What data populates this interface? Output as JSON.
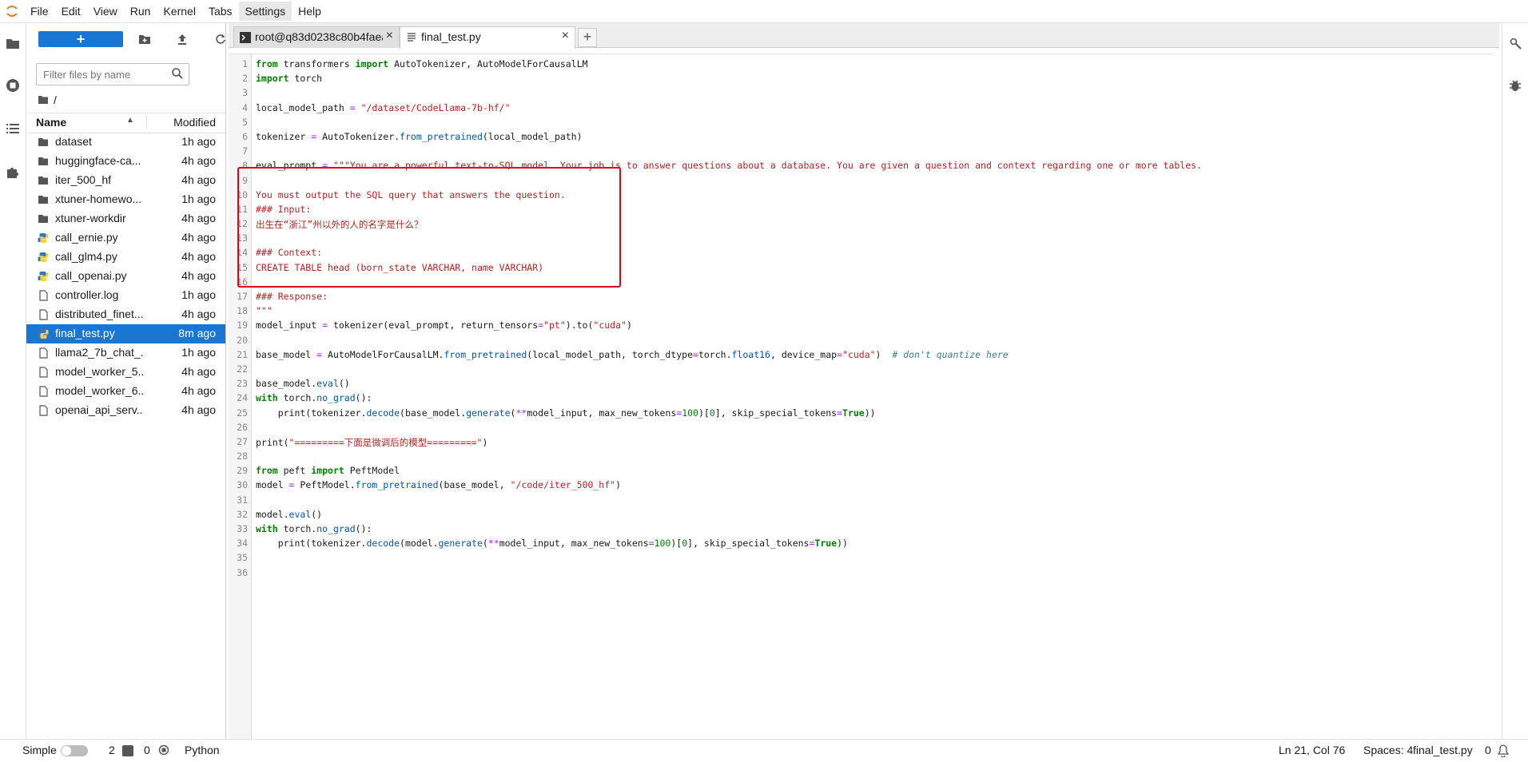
{
  "menubar": {
    "items": [
      "File",
      "Edit",
      "View",
      "Run",
      "Kernel",
      "Tabs",
      "Settings",
      "Help"
    ],
    "active": "Settings"
  },
  "filebrowser": {
    "new_label": "+",
    "filter_placeholder": "Filter files by name",
    "path": "/",
    "columns": {
      "name": "Name",
      "modified": "Modified"
    },
    "files": [
      {
        "name": "dataset",
        "time": "1h ago",
        "type": "folder"
      },
      {
        "name": "huggingface-ca...",
        "time": "4h ago",
        "type": "folder"
      },
      {
        "name": "iter_500_hf",
        "time": "4h ago",
        "type": "folder"
      },
      {
        "name": "xtuner-homewo...",
        "time": "1h ago",
        "type": "folder"
      },
      {
        "name": "xtuner-workdir",
        "time": "4h ago",
        "type": "folder"
      },
      {
        "name": "call_ernie.py",
        "time": "4h ago",
        "type": "python"
      },
      {
        "name": "call_glm4.py",
        "time": "4h ago",
        "type": "python"
      },
      {
        "name": "call_openai.py",
        "time": "4h ago",
        "type": "python"
      },
      {
        "name": "controller.log",
        "time": "1h ago",
        "type": "file"
      },
      {
        "name": "distributed_finet...",
        "time": "4h ago",
        "type": "file"
      },
      {
        "name": "final_test.py",
        "time": "8m ago",
        "type": "python",
        "selected": true
      },
      {
        "name": "llama2_7b_chat_...",
        "time": "1h ago",
        "type": "file"
      },
      {
        "name": "model_worker_5...",
        "time": "4h ago",
        "type": "file"
      },
      {
        "name": "model_worker_6...",
        "time": "4h ago",
        "type": "file"
      },
      {
        "name": "openai_api_serv...",
        "time": "4h ago",
        "type": "file"
      }
    ]
  },
  "tabs": [
    {
      "label": "root@q83d0238c80b4faea",
      "icon": "terminal-icon"
    },
    {
      "label": "final_test.py",
      "icon": "text-file-icon",
      "active": true
    }
  ],
  "status": {
    "mode": "Simple",
    "terminals": "2",
    "kernels": "0",
    "kernel_name": "Python",
    "position": "Ln 21, Col 76",
    "spaces": "Spaces: 4",
    "file": "final_test.py",
    "notifications": "0"
  },
  "colors": {
    "accent": "#1976d2",
    "highlight_box": "#e3000f"
  }
}
